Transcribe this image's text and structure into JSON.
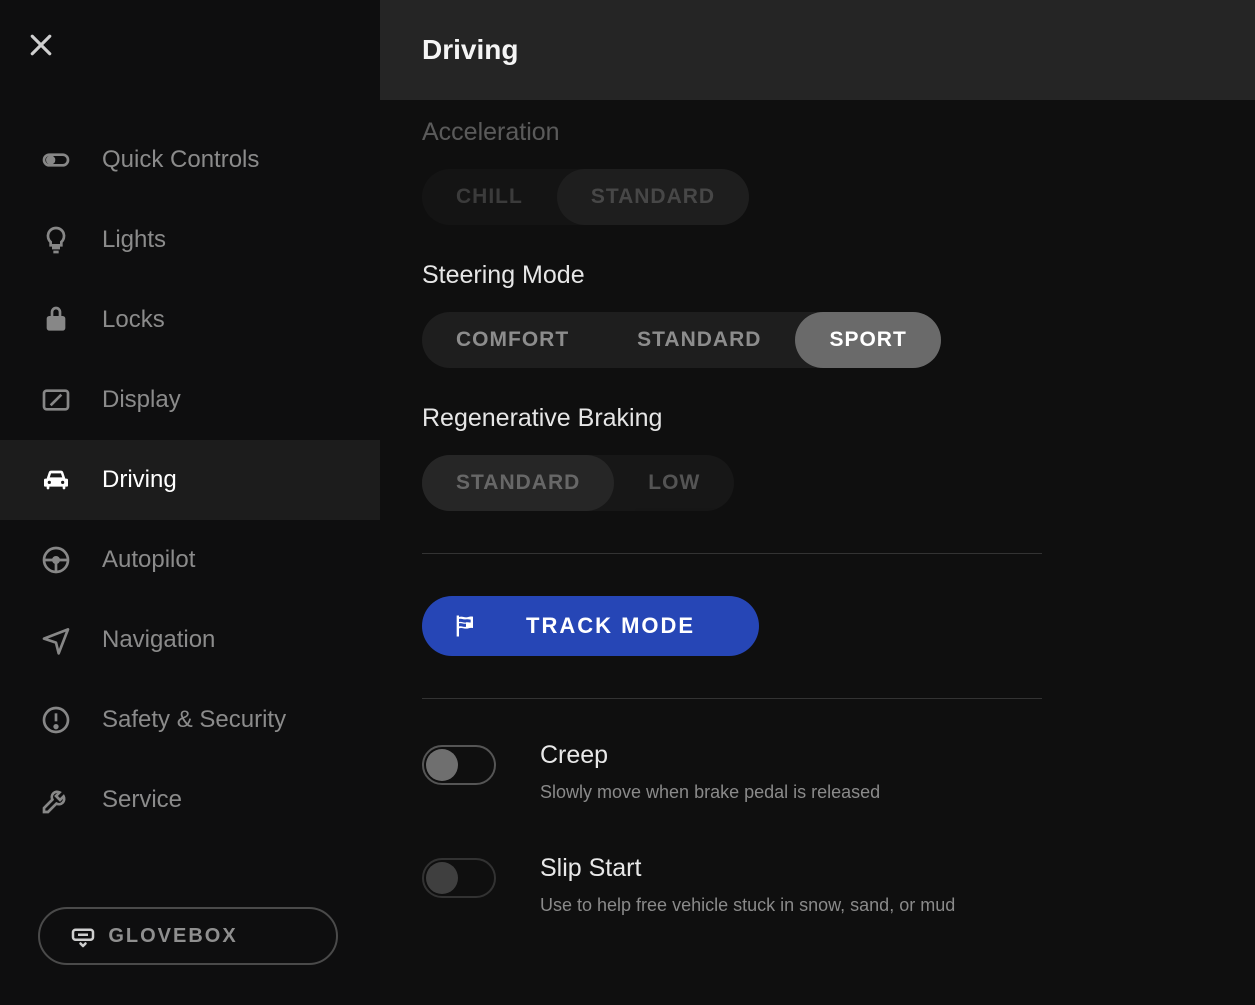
{
  "header": {
    "title": "Driving"
  },
  "sidebar": {
    "items": [
      {
        "label": "Quick Controls"
      },
      {
        "label": "Lights"
      },
      {
        "label": "Locks"
      },
      {
        "label": "Display"
      },
      {
        "label": "Driving"
      },
      {
        "label": "Autopilot"
      },
      {
        "label": "Navigation"
      },
      {
        "label": "Safety & Security"
      },
      {
        "label": "Service"
      }
    ],
    "glovebox_label": "GLOVEBOX"
  },
  "sections": {
    "acceleration": {
      "title": "Acceleration",
      "options": [
        "CHILL",
        "STANDARD"
      ],
      "selected": "STANDARD"
    },
    "steering": {
      "title": "Steering Mode",
      "options": [
        "COMFORT",
        "STANDARD",
        "SPORT"
      ],
      "selected": "SPORT"
    },
    "regen": {
      "title": "Regenerative Braking",
      "options": [
        "STANDARD",
        "LOW"
      ],
      "selected": "STANDARD"
    }
  },
  "track_mode_label": "TRACK MODE",
  "toggles": {
    "creep": {
      "title": "Creep",
      "desc": "Slowly move when brake pedal is released",
      "on": false
    },
    "slip": {
      "title": "Slip Start",
      "desc": "Use to help free vehicle stuck in snow, sand, or mud",
      "on": false
    }
  }
}
